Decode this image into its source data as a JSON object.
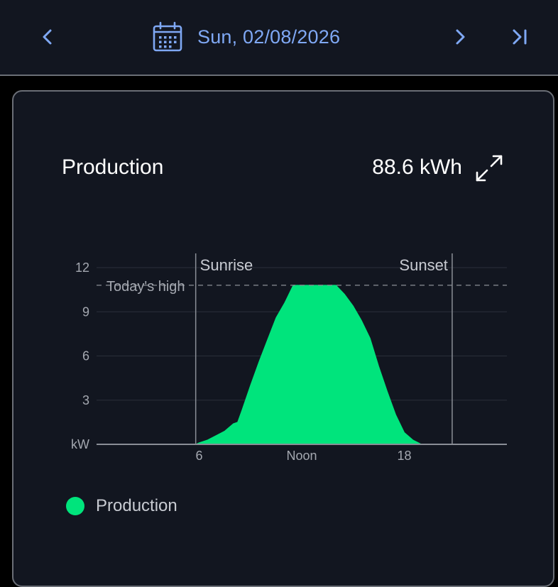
{
  "header": {
    "date": "Sun, 02/08/2026",
    "icons": {
      "prev": "chevron-left-icon",
      "calendar": "calendar-icon",
      "next": "chevron-right-icon",
      "last": "skip-to-end-icon"
    },
    "accent_color": "#7fa8f4"
  },
  "card": {
    "title": "Production",
    "total": "88.6 kWh",
    "expand_icon": "expand-icon"
  },
  "legend": {
    "label": "Production",
    "color": "#00e47c"
  },
  "chart_data": {
    "type": "area",
    "title": "",
    "ylabel": "kW",
    "y_ticks": [
      3,
      6,
      9,
      12
    ],
    "x_ticks": [
      "6",
      "Noon",
      "18"
    ],
    "x_tick_values": [
      6,
      12,
      18
    ],
    "xlim": [
      0,
      24
    ],
    "ylim": [
      0,
      12
    ],
    "grid": true,
    "series": [
      {
        "name": "Production",
        "color": "#00e47c",
        "x": [
          0,
          5.8,
          6,
          6.5,
          7,
          7.5,
          8,
          8.25,
          8.5,
          9,
          9.5,
          10,
          10.5,
          11,
          11.5,
          12,
          12.5,
          13,
          13.5,
          14,
          14.5,
          15,
          15.5,
          16,
          16.5,
          17,
          17.5,
          18,
          18.5,
          19,
          19.5,
          20,
          21.5,
          24
        ],
        "y": [
          0,
          0,
          0.1,
          0.3,
          0.6,
          0.9,
          1.4,
          1.5,
          2.3,
          4.0,
          5.6,
          7.1,
          8.6,
          9.6,
          10.8,
          10.8,
          10.8,
          10.8,
          10.8,
          10.8,
          10.2,
          9.4,
          8.4,
          7.2,
          5.3,
          3.6,
          2.0,
          0.8,
          0.3,
          0,
          0,
          0,
          0,
          0
        ]
      }
    ],
    "reference_lines": [
      {
        "label": "Today's high",
        "value": 10.8,
        "style": "dashed"
      }
    ],
    "markers": [
      {
        "label": "Sunrise",
        "x": 5.8
      },
      {
        "label": "Sunset",
        "x": 20.8
      }
    ]
  }
}
